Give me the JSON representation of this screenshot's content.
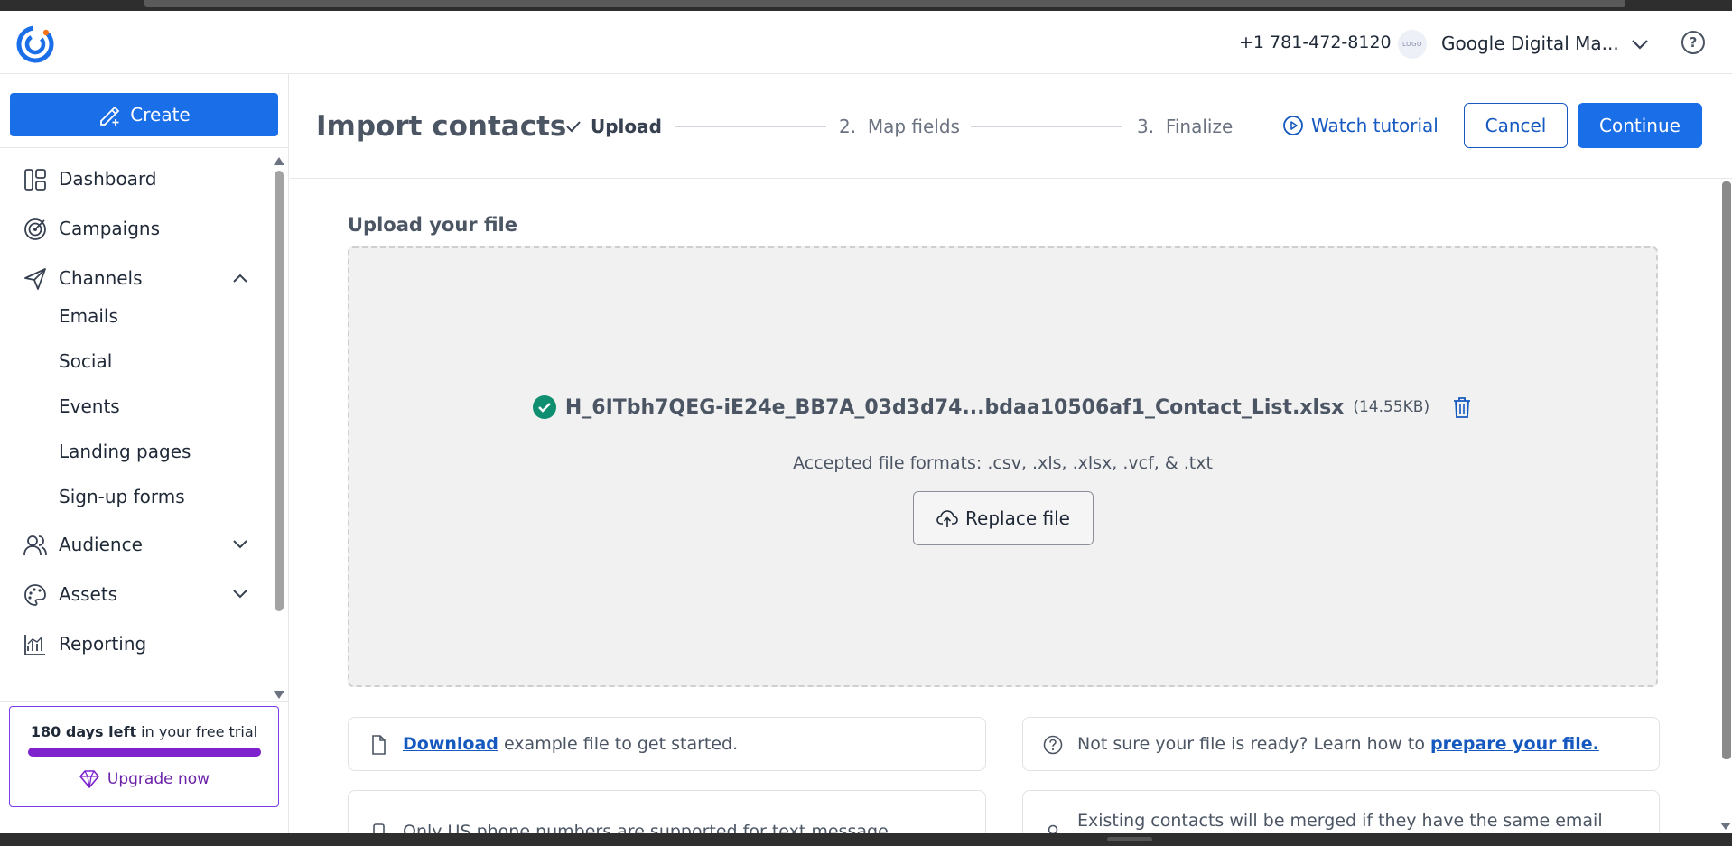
{
  "header": {
    "phone": "+1 781-472-8120",
    "account_logo_text": "LOGO",
    "account_name": "Google Digital Ma...",
    "help_symbol": "?"
  },
  "sidebar": {
    "create_label": "Create",
    "items": [
      {
        "label": "Dashboard",
        "icon": "dashboard-icon"
      },
      {
        "label": "Campaigns",
        "icon": "target-icon"
      },
      {
        "label": "Channels",
        "icon": "send-icon",
        "expanded": true
      },
      {
        "label": "Emails"
      },
      {
        "label": "Social"
      },
      {
        "label": "Events"
      },
      {
        "label": "Landing pages"
      },
      {
        "label": "Sign-up forms"
      },
      {
        "label": "Audience",
        "icon": "users-icon",
        "expanded": false
      },
      {
        "label": "Assets",
        "icon": "palette-icon",
        "expanded": false
      },
      {
        "label": "Reporting",
        "icon": "chart-icon"
      }
    ],
    "trial": {
      "days_bold": "180 days left",
      "days_rest": " in your free trial",
      "progress": 1.0,
      "upgrade_label": "Upgrade now"
    }
  },
  "page": {
    "title": "Import contacts",
    "steps": {
      "step1": "Upload",
      "step2_num": "2.",
      "step2": "Map fields",
      "step3_num": "3.",
      "step3": "Finalize"
    },
    "watch_tutorial": "Watch tutorial",
    "cancel": "Cancel",
    "continue": "Continue"
  },
  "upload": {
    "section_title": "Upload your file",
    "file_name": "H_6ITbh7QEG-iE24e_BB7A_03d3d74...bdaa10506af1_Contact_List.xlsx",
    "file_size": "(14.55KB)",
    "formats": "Accepted file formats: .csv, .xls, .xlsx, .vcf, & .txt",
    "replace_label": "Replace file"
  },
  "cards": {
    "download_link": "Download",
    "download_text": " example file to get started.",
    "prepare_text": "Not sure your file is ready? Learn how to ",
    "prepare_link": "prepare your file.",
    "phone_text": "Only US phone numbers are supported for text message marketing.",
    "merge_text": "Existing contacts will be merged if they have the same email address."
  },
  "colors": {
    "primary": "#1a6ee8",
    "link": "#1558c0",
    "trial_purple": "#7e22ce",
    "success_green": "#0f8f6f"
  }
}
